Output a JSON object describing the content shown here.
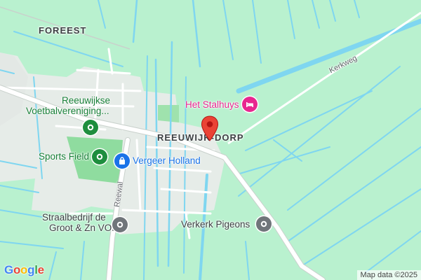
{
  "map": {
    "colors": {
      "land": "#b9f1cf",
      "water": "#7fd6f0",
      "built_area": "#e6ece8",
      "park": "#8fdc9f",
      "road": "#ffffff",
      "road_edge": "#c9d1cc",
      "marker": "#ea4335"
    },
    "area_labels": {
      "foreest": "FOREEST",
      "reeuwijk_dorp": "REEUWIJK-DORP"
    },
    "places": {
      "voetbal": {
        "line1": "Reeuwijkse",
        "line2": "Voetbalvereniging...",
        "icon": "pin-icon",
        "color": "#1e8e3e"
      },
      "sports_field": {
        "label": "Sports Field",
        "icon": "pin-icon",
        "color": "#1e8e3e"
      },
      "vergeer": {
        "label": "Vergeer Holland",
        "icon": "shopping-bag-icon",
        "color": "#1a73e8"
      },
      "stalhuys": {
        "label": "Het Stalhuys",
        "icon": "bed-icon",
        "color": "#e8268f"
      },
      "straalbedrijf": {
        "line1": "Straalbedrijf de",
        "line2": "Groot & Zn VOF",
        "icon": "pin-icon",
        "color": "#70757a"
      },
      "verkerk": {
        "label": "Verkerk Pigeons",
        "icon": "pin-icon",
        "color": "#70757a"
      }
    },
    "roads": {
      "kerkweg": "Kerkweg",
      "reewal": "Reewal"
    },
    "attribution": "Map data ©2025",
    "logo": {
      "text": "Google",
      "letters": [
        {
          "char": "G",
          "color": "#4285f4"
        },
        {
          "char": "o",
          "color": "#ea4335"
        },
        {
          "char": "o",
          "color": "#fbbc05"
        },
        {
          "char": "g",
          "color": "#4285f4"
        },
        {
          "char": "l",
          "color": "#34a853"
        },
        {
          "char": "e",
          "color": "#ea4335"
        }
      ]
    }
  }
}
